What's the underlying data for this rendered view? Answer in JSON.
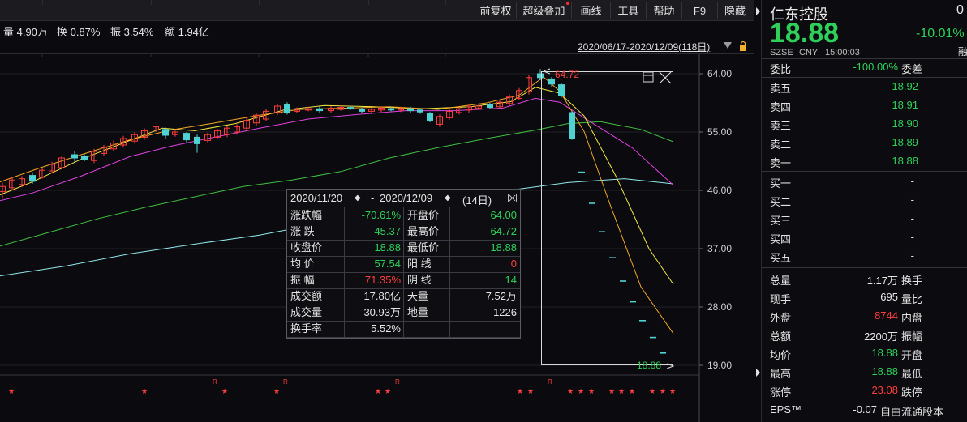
{
  "toolbar": {
    "buttons": [
      "前复权",
      "超级叠加",
      "画线",
      "工具",
      "帮助",
      "F9",
      "隐藏"
    ]
  },
  "stats": {
    "volume": "量 4.90万",
    "turnover": "换 0.87%",
    "amplitude": "振 3.54%",
    "amount": "额 1.94亿"
  },
  "chart_header": {
    "range": "2020/06/17-2020/12/09(118日)"
  },
  "chart_data": {
    "type": "candlestick",
    "y_ticks": [
      "64.00",
      "55.00",
      "46.00",
      "37.00",
      "28.00",
      "19.00"
    ],
    "ylim": [
      19,
      64
    ],
    "high_label": "64.72",
    "last_label": "18.88",
    "marker_star": "★",
    "marker_r": "R"
  },
  "popup": {
    "range_start": "2020/11/20",
    "range_end": "2020/12/09",
    "days": "(14日)",
    "arrows": "◆",
    "dash": "-",
    "rows": [
      {
        "k1": "涨跌幅",
        "v1": "-70.61%",
        "k2": "开盘价",
        "v2": "64.00"
      },
      {
        "k1": "涨  跌",
        "v1": "-45.37",
        "k2": "最高价",
        "v2": "64.72"
      },
      {
        "k1": "收盘价",
        "v1": "18.88",
        "k2": "最低价",
        "v2": "18.88"
      },
      {
        "k1": "均  价",
        "v1": "57.54",
        "k2": "阳  线",
        "v2": "0"
      },
      {
        "k1": "振  幅",
        "v1": "71.35%",
        "k2": "阴  线",
        "v2": "14"
      },
      {
        "k1": "成交额",
        "v1": "17.80亿",
        "k2": "天量",
        "v2": "7.52万"
      },
      {
        "k1": "成交量",
        "v1": "30.93万",
        "k2": "地量",
        "v2": "1226"
      },
      {
        "k1": "换手率",
        "v1": "5.52%",
        "k2": "",
        "v2": ""
      }
    ]
  },
  "panel": {
    "name": "仁东控股",
    "price": "18.88",
    "change_pct": "-10.01%",
    "market": "SZSE",
    "currency": "CNY",
    "time": "15:00:03",
    "corner": "0",
    "corner2": "融",
    "weibi_label": "委比",
    "weibi_value": "-100.00%",
    "weicha_label": "委差",
    "sell": [
      {
        "label": "卖五",
        "price": "18.92"
      },
      {
        "label": "卖四",
        "price": "18.91"
      },
      {
        "label": "卖三",
        "price": "18.90"
      },
      {
        "label": "卖二",
        "price": "18.89"
      },
      {
        "label": "卖一",
        "price": "18.88"
      }
    ],
    "buy": [
      {
        "label": "买一",
        "price": "-"
      },
      {
        "label": "买二",
        "price": "-"
      },
      {
        "label": "买三",
        "price": "-"
      },
      {
        "label": "买四",
        "price": "-"
      },
      {
        "label": "买五",
        "price": "-"
      }
    ],
    "details": [
      {
        "k1": "总量",
        "v1": "1.17万",
        "k2": "换手"
      },
      {
        "k1": "现手",
        "v1": "695",
        "k2": "量比"
      },
      {
        "k1": "外盘",
        "v1": "8744",
        "k2": "内盘"
      },
      {
        "k1": "总额",
        "v1": "2200万",
        "k2": "振幅"
      },
      {
        "k1": "均价",
        "v1": "18.88",
        "k2": "开盘"
      },
      {
        "k1": "最高",
        "v1": "18.88",
        "k2": "最低"
      },
      {
        "k1": "涨停",
        "v1": "23.08",
        "k2": "跌停"
      }
    ],
    "eps_label": "EPS™",
    "eps_value": "-0.07",
    "eps_k2": "自由流通股本"
  },
  "colors": {
    "up": "#ff3c3c",
    "down": "#2ed05a",
    "cyan": "#4fd2d2",
    "ma5": "#ffffff",
    "ma10": "#f5e942",
    "ma20": "#e040e0",
    "ma30": "#3fbf3f",
    "ma60": "#8fe8ea",
    "orange": "#f5a623"
  }
}
